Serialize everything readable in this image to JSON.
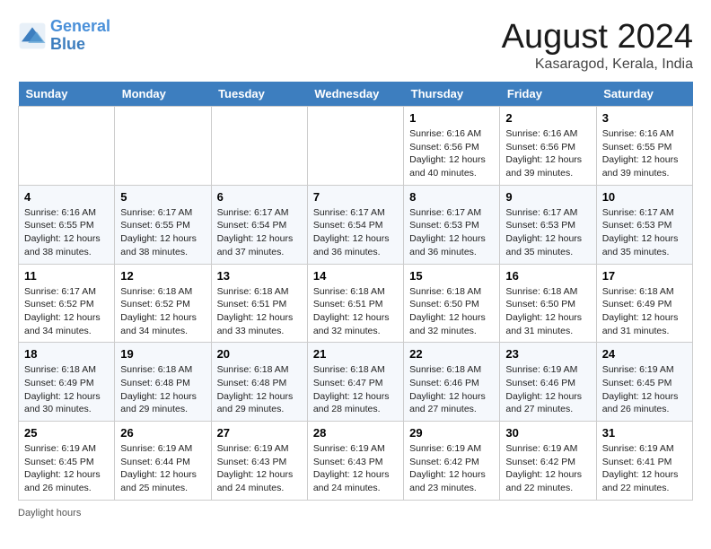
{
  "header": {
    "logo_line1": "General",
    "logo_line2": "Blue",
    "month_title": "August 2024",
    "location": "Kasaragod, Kerala, India"
  },
  "footer": {
    "daylight_label": "Daylight hours"
  },
  "days_of_week": [
    "Sunday",
    "Monday",
    "Tuesday",
    "Wednesday",
    "Thursday",
    "Friday",
    "Saturday"
  ],
  "weeks": [
    [
      {
        "day": "",
        "info": ""
      },
      {
        "day": "",
        "info": ""
      },
      {
        "day": "",
        "info": ""
      },
      {
        "day": "",
        "info": ""
      },
      {
        "day": "1",
        "info": "Sunrise: 6:16 AM\nSunset: 6:56 PM\nDaylight: 12 hours\nand 40 minutes."
      },
      {
        "day": "2",
        "info": "Sunrise: 6:16 AM\nSunset: 6:56 PM\nDaylight: 12 hours\nand 39 minutes."
      },
      {
        "day": "3",
        "info": "Sunrise: 6:16 AM\nSunset: 6:55 PM\nDaylight: 12 hours\nand 39 minutes."
      }
    ],
    [
      {
        "day": "4",
        "info": "Sunrise: 6:16 AM\nSunset: 6:55 PM\nDaylight: 12 hours\nand 38 minutes."
      },
      {
        "day": "5",
        "info": "Sunrise: 6:17 AM\nSunset: 6:55 PM\nDaylight: 12 hours\nand 38 minutes."
      },
      {
        "day": "6",
        "info": "Sunrise: 6:17 AM\nSunset: 6:54 PM\nDaylight: 12 hours\nand 37 minutes."
      },
      {
        "day": "7",
        "info": "Sunrise: 6:17 AM\nSunset: 6:54 PM\nDaylight: 12 hours\nand 36 minutes."
      },
      {
        "day": "8",
        "info": "Sunrise: 6:17 AM\nSunset: 6:53 PM\nDaylight: 12 hours\nand 36 minutes."
      },
      {
        "day": "9",
        "info": "Sunrise: 6:17 AM\nSunset: 6:53 PM\nDaylight: 12 hours\nand 35 minutes."
      },
      {
        "day": "10",
        "info": "Sunrise: 6:17 AM\nSunset: 6:53 PM\nDaylight: 12 hours\nand 35 minutes."
      }
    ],
    [
      {
        "day": "11",
        "info": "Sunrise: 6:17 AM\nSunset: 6:52 PM\nDaylight: 12 hours\nand 34 minutes."
      },
      {
        "day": "12",
        "info": "Sunrise: 6:18 AM\nSunset: 6:52 PM\nDaylight: 12 hours\nand 34 minutes."
      },
      {
        "day": "13",
        "info": "Sunrise: 6:18 AM\nSunset: 6:51 PM\nDaylight: 12 hours\nand 33 minutes."
      },
      {
        "day": "14",
        "info": "Sunrise: 6:18 AM\nSunset: 6:51 PM\nDaylight: 12 hours\nand 32 minutes."
      },
      {
        "day": "15",
        "info": "Sunrise: 6:18 AM\nSunset: 6:50 PM\nDaylight: 12 hours\nand 32 minutes."
      },
      {
        "day": "16",
        "info": "Sunrise: 6:18 AM\nSunset: 6:50 PM\nDaylight: 12 hours\nand 31 minutes."
      },
      {
        "day": "17",
        "info": "Sunrise: 6:18 AM\nSunset: 6:49 PM\nDaylight: 12 hours\nand 31 minutes."
      }
    ],
    [
      {
        "day": "18",
        "info": "Sunrise: 6:18 AM\nSunset: 6:49 PM\nDaylight: 12 hours\nand 30 minutes."
      },
      {
        "day": "19",
        "info": "Sunrise: 6:18 AM\nSunset: 6:48 PM\nDaylight: 12 hours\nand 29 minutes."
      },
      {
        "day": "20",
        "info": "Sunrise: 6:18 AM\nSunset: 6:48 PM\nDaylight: 12 hours\nand 29 minutes."
      },
      {
        "day": "21",
        "info": "Sunrise: 6:18 AM\nSunset: 6:47 PM\nDaylight: 12 hours\nand 28 minutes."
      },
      {
        "day": "22",
        "info": "Sunrise: 6:18 AM\nSunset: 6:46 PM\nDaylight: 12 hours\nand 27 minutes."
      },
      {
        "day": "23",
        "info": "Sunrise: 6:19 AM\nSunset: 6:46 PM\nDaylight: 12 hours\nand 27 minutes."
      },
      {
        "day": "24",
        "info": "Sunrise: 6:19 AM\nSunset: 6:45 PM\nDaylight: 12 hours\nand 26 minutes."
      }
    ],
    [
      {
        "day": "25",
        "info": "Sunrise: 6:19 AM\nSunset: 6:45 PM\nDaylight: 12 hours\nand 26 minutes."
      },
      {
        "day": "26",
        "info": "Sunrise: 6:19 AM\nSunset: 6:44 PM\nDaylight: 12 hours\nand 25 minutes."
      },
      {
        "day": "27",
        "info": "Sunrise: 6:19 AM\nSunset: 6:43 PM\nDaylight: 12 hours\nand 24 minutes."
      },
      {
        "day": "28",
        "info": "Sunrise: 6:19 AM\nSunset: 6:43 PM\nDaylight: 12 hours\nand 24 minutes."
      },
      {
        "day": "29",
        "info": "Sunrise: 6:19 AM\nSunset: 6:42 PM\nDaylight: 12 hours\nand 23 minutes."
      },
      {
        "day": "30",
        "info": "Sunrise: 6:19 AM\nSunset: 6:42 PM\nDaylight: 12 hours\nand 22 minutes."
      },
      {
        "day": "31",
        "info": "Sunrise: 6:19 AM\nSunset: 6:41 PM\nDaylight: 12 hours\nand 22 minutes."
      }
    ]
  ]
}
